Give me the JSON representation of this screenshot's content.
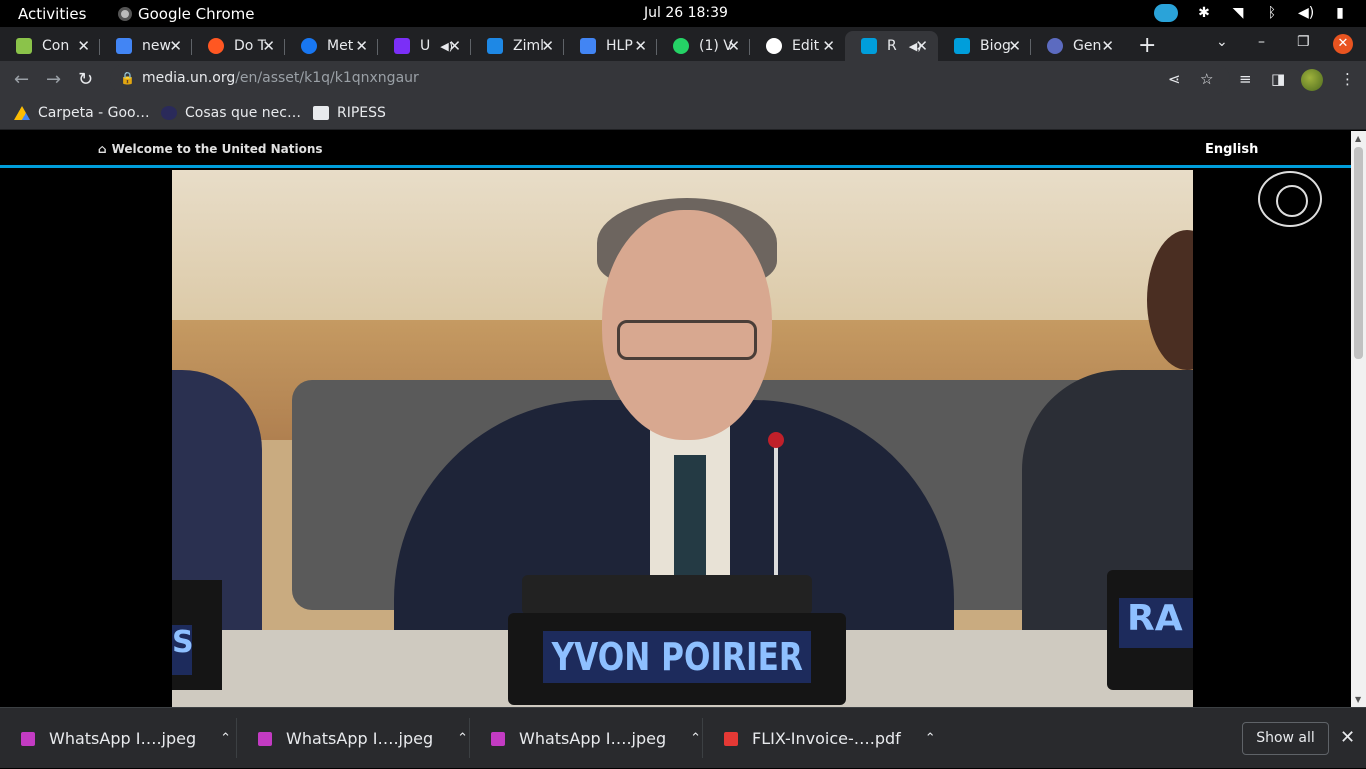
{
  "system": {
    "activities": "Activities",
    "app_name": "Google Chrome",
    "clock": "Jul 26  18:39"
  },
  "tabs": [
    {
      "title": "Con",
      "color": "#8bc34a"
    },
    {
      "title": "new",
      "color": "#4285f4"
    },
    {
      "title": "Do T",
      "color": "#ff5722"
    },
    {
      "title": "Met",
      "color": "#1877f2"
    },
    {
      "title": "U",
      "color": "#7b2ff7"
    },
    {
      "title": "Ziml",
      "color": "#1e88e5"
    },
    {
      "title": "HLP",
      "color": "#4285f4"
    },
    {
      "title": "(1) V",
      "color": "#25d366"
    },
    {
      "title": "Edit",
      "color": "#ffffff"
    },
    {
      "title": "R",
      "color": "#009edb"
    },
    {
      "title": "Biog",
      "color": "#009edb"
    },
    {
      "title": "Gen",
      "color": "#5c6bc0"
    }
  ],
  "omnibox": {
    "host": "media.un.org",
    "path": "/en/asset/k1q/k1qnxngaur"
  },
  "bookmarks": [
    {
      "label": "Carpeta - Goo…"
    },
    {
      "label": "Cosas que nec…"
    },
    {
      "label": "RIPESS"
    }
  ],
  "un": {
    "welcome": "Welcome to the United Nations",
    "language": "English"
  },
  "video": {
    "nameplate": "YVON POIRIER",
    "right_plate": "RA",
    "left_plate": "S"
  },
  "downloads": [
    {
      "name": "WhatsApp I….jpeg",
      "color": "#c33bc3"
    },
    {
      "name": "WhatsApp I….jpeg",
      "color": "#c33bc3"
    },
    {
      "name": "WhatsApp I….jpeg",
      "color": "#c33bc3"
    },
    {
      "name": "FLIX-Invoice-….pdf",
      "color": "#e53935"
    }
  ],
  "download_bar": {
    "show_all": "Show all"
  }
}
